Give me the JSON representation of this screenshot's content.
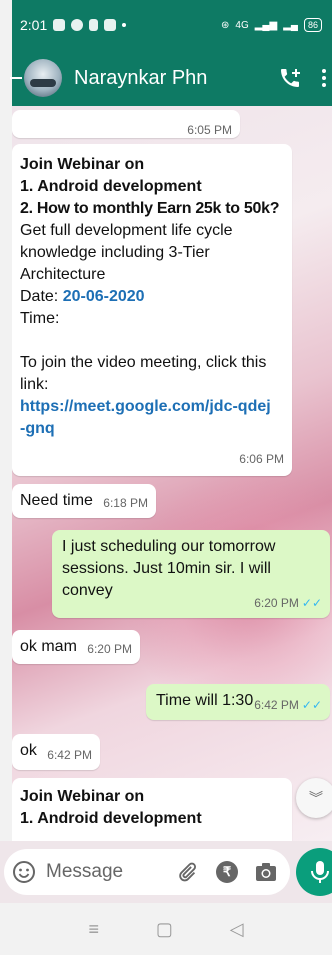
{
  "status_bar": {
    "time": "2:01",
    "signal_text": "4G",
    "battery": "86"
  },
  "header": {
    "contact_name": "Naraynkar Phn",
    "call_icon": "add-call-icon",
    "more_icon": "more-vert-icon"
  },
  "messages": [
    {
      "direction": "in",
      "time": "6:05 PM"
    },
    {
      "direction": "in",
      "lines": [
        "Join  Webinar on",
        "1. Android development",
        "2. How to monthly Earn 25k to 50k?",
        "Get full development life cycle",
        "knowledge including 3-Tier",
        "Architecture"
      ],
      "date_label": "Date: ",
      "date_value": "20-06-2020",
      "time_label": "Time:",
      "join_text_1": "To join the video meeting, click this",
      "join_text_2": "link:",
      "link_1": "https://meet.google.com/jdc-qdej",
      "link_2": "-gnq",
      "time": "6:06 PM"
    },
    {
      "direction": "in",
      "text": "Need time",
      "time": "6:18 PM"
    },
    {
      "direction": "out",
      "lines": [
        "I just scheduling our tomorrow",
        "sessions. Just 10min sir. I will",
        "convey"
      ],
      "time": "6:20 PM",
      "read": true
    },
    {
      "direction": "in",
      "text": "ok mam",
      "time": "6:20 PM"
    },
    {
      "direction": "out",
      "text": "Time will 1:30",
      "time": "6:42 PM",
      "read": true
    },
    {
      "direction": "in",
      "text": "ok",
      "time": "6:42 PM"
    },
    {
      "direction": "in",
      "lines": [
        "Join  Webinar on",
        "1. Android development"
      ]
    }
  ],
  "input": {
    "placeholder": "Message",
    "emoji_icon": "emoji-icon",
    "attach_icon": "paperclip-icon",
    "payment_icon": "rupee-icon",
    "camera_icon": "camera-icon",
    "mic_icon": "mic-icon"
  },
  "nav": {
    "menu": "≡",
    "home": "▢",
    "back": "◁"
  },
  "colors": {
    "header": "#0e7a64",
    "outgoing_bubble": "#dcf8c6",
    "incoming_bubble": "#ffffff",
    "link": "#1d6fb5",
    "read_ticks": "#34b7f1",
    "mic_button": "#0a9e7c"
  }
}
